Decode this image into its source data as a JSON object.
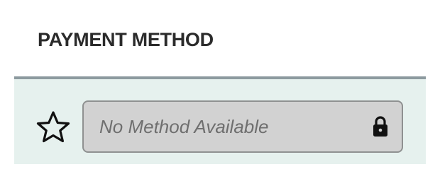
{
  "payment": {
    "title": "PAYMENT METHOD",
    "field": {
      "placeholder": "No Method Available",
      "locked": true
    },
    "icons": {
      "favorite": "star-outline-icon",
      "lock": "lock-icon"
    }
  }
}
